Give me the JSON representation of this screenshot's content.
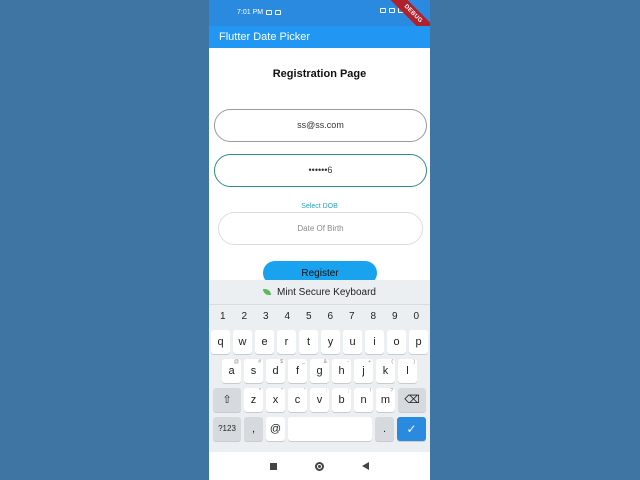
{
  "status_bar": {
    "time": "7:01 PM",
    "debug_label": "DEBUG"
  },
  "app_bar": {
    "title": "Flutter Date Picker"
  },
  "page": {
    "title": "Registration Page",
    "email_value": "ss@ss.com",
    "password_value": "••••••6",
    "dob_label": "Select DOB",
    "dob_placeholder": "Date Of Birth",
    "register_label": "Register"
  },
  "keyboard": {
    "title": "Mint Secure Keyboard",
    "numbers": [
      "1",
      "2",
      "3",
      "4",
      "5",
      "6",
      "7",
      "8",
      "9",
      "0"
    ],
    "row1": [
      "q",
      "w",
      "e",
      "r",
      "t",
      "y",
      "u",
      "i",
      "o",
      "p"
    ],
    "row2": [
      "a",
      "s",
      "d",
      "f",
      "g",
      "h",
      "j",
      "k",
      "l"
    ],
    "row2_hints": [
      "@",
      "#",
      "$",
      "_",
      "&",
      "-",
      "+",
      "(",
      ")"
    ],
    "row3": [
      "z",
      "x",
      "c",
      "v",
      "b",
      "n",
      "m"
    ],
    "row3_hints": [
      "*",
      "\"",
      "'",
      ":",
      ";",
      "!",
      "?"
    ],
    "symbols_label": "?123",
    "comma": ",",
    "at": "@",
    "period": ".",
    "shift": "⇧",
    "backspace": "⌫",
    "enter": "✓"
  }
}
